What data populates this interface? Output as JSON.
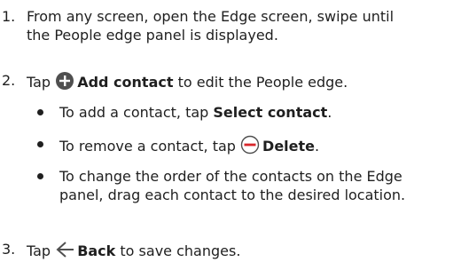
{
  "steps": [
    {
      "number": "1.",
      "text_line1": "From any screen, open the Edge screen, swipe until",
      "text_line2": "the People edge panel is displayed."
    },
    {
      "number": "2.",
      "pre": "Tap",
      "icon": "plus-circle-icon",
      "bold": "Add contact",
      "post": "to edit the People edge."
    },
    {
      "number": "3.",
      "pre": "Tap",
      "icon": "back-arrow-icon",
      "bold": "Back",
      "post": "to save changes."
    }
  ],
  "bullets": [
    {
      "pre": "To add a contact, tap",
      "bold": "Select contact",
      "post": "."
    },
    {
      "pre": "To remove a contact, tap",
      "icon": "minus-circle-icon",
      "bold": "Delete",
      "post": "."
    },
    {
      "line1": "To change the order of the contacts on the Edge",
      "line2": "panel, drag each contact to the desired location."
    }
  ],
  "colors": {
    "text": "#1f1f1f",
    "add_icon": "#4f4f4f",
    "delete_icon": "#d8262b",
    "back_icon": "#4f4f4f"
  }
}
